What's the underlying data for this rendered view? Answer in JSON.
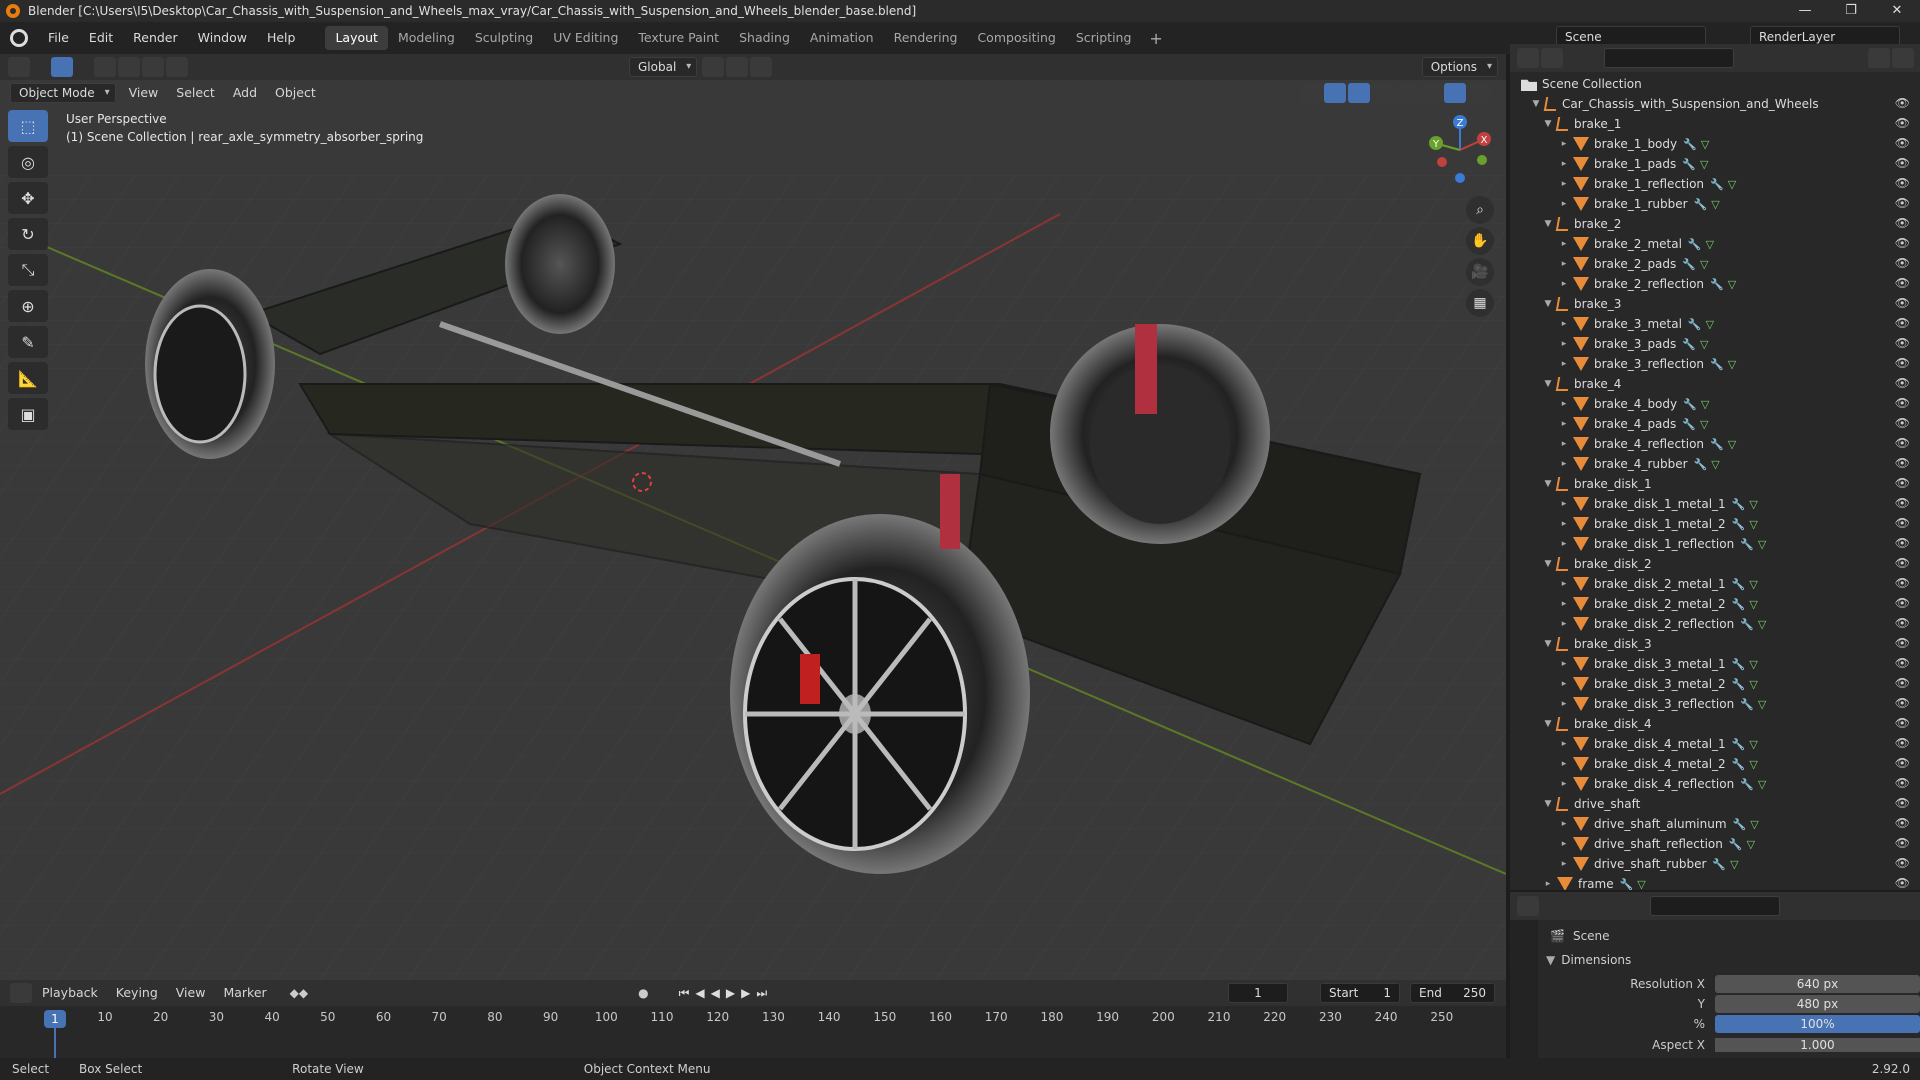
{
  "window": {
    "title": "Blender [C:\\Users\\I5\\Desktop\\Car_Chassis_with_Suspension_and_Wheels_max_vray/Car_Chassis_with_Suspension_and_Wheels_blender_base.blend]",
    "minimize": "—",
    "maximize": "❐",
    "close": "✕"
  },
  "menubar": {
    "menus": [
      "File",
      "Edit",
      "Render",
      "Window",
      "Help"
    ],
    "workspaces": [
      "Layout",
      "Modeling",
      "Sculpting",
      "UV Editing",
      "Texture Paint",
      "Shading",
      "Animation",
      "Rendering",
      "Compositing",
      "Scripting"
    ],
    "active_workspace": "Layout",
    "add": "+",
    "scene": "Scene",
    "view_layer": "RenderLayer"
  },
  "viewport_header": {
    "transform_orientation": "Global",
    "options": "Options",
    "mode": "Object Mode",
    "menus": [
      "View",
      "Select",
      "Add",
      "Object"
    ]
  },
  "viewport": {
    "perspective": "User Perspective",
    "context": "(1) Scene Collection | rear_axle_symmetry_absorber_spring",
    "gizmo": {
      "x": "X",
      "y": "Y",
      "z": "Z"
    }
  },
  "outliner": {
    "root": "Scene Collection",
    "collection": "Car_Chassis_with_Suspension_and_Wheels",
    "groups": [
      {
        "name": "brake_1",
        "children": [
          "brake_1_body",
          "brake_1_pads",
          "brake_1_reflection",
          "brake_1_rubber"
        ]
      },
      {
        "name": "brake_2",
        "children": [
          "brake_2_metal",
          "brake_2_pads",
          "brake_2_reflection"
        ]
      },
      {
        "name": "brake_3",
        "children": [
          "brake_3_metal",
          "brake_3_pads",
          "brake_3_reflection"
        ]
      },
      {
        "name": "brake_4",
        "children": [
          "brake_4_body",
          "brake_4_pads",
          "brake_4_reflection",
          "brake_4_rubber"
        ]
      },
      {
        "name": "brake_disk_1",
        "children": [
          "brake_disk_1_metal_1",
          "brake_disk_1_metal_2",
          "brake_disk_1_reflection"
        ]
      },
      {
        "name": "brake_disk_2",
        "children": [
          "brake_disk_2_metal_1",
          "brake_disk_2_metal_2",
          "brake_disk_2_reflection"
        ]
      },
      {
        "name": "brake_disk_3",
        "children": [
          "brake_disk_3_metal_1",
          "brake_disk_3_metal_2",
          "brake_disk_3_reflection"
        ]
      },
      {
        "name": "brake_disk_4",
        "children": [
          "brake_disk_4_metal_1",
          "brake_disk_4_metal_2",
          "brake_disk_4_reflection"
        ]
      },
      {
        "name": "drive_shaft",
        "children": [
          "drive_shaft_aluminum",
          "drive_shaft_reflection",
          "drive_shaft_rubber"
        ]
      }
    ],
    "last_item": "frame"
  },
  "properties": {
    "scene": "Scene",
    "panel": "Dimensions",
    "resolution_x_label": "Resolution X",
    "resolution_x": "640 px",
    "y_label": "Y",
    "resolution_y": "480 px",
    "pct_label": "%",
    "resolution_pct": "100%",
    "aspect_label": "Aspect X",
    "aspect_x": "1.000"
  },
  "timeline": {
    "menus": [
      "Playback",
      "Keying",
      "View",
      "Marker"
    ],
    "current_frame": "1",
    "start_label": "Start",
    "start": "1",
    "end_label": "End",
    "end": "250",
    "ticks": [
      "10",
      "20",
      "30",
      "40",
      "50",
      "60",
      "70",
      "80",
      "90",
      "100",
      "110",
      "120",
      "130",
      "140",
      "150",
      "160",
      "170",
      "180",
      "190",
      "200",
      "210",
      "220",
      "230",
      "240",
      "250"
    ],
    "playhead": "1"
  },
  "statusbar": {
    "select": "Select",
    "box_select": "Box Select",
    "rotate": "Rotate View",
    "context_menu": "Object Context Menu",
    "version": "2.92.0"
  },
  "colors": {
    "accent": "#4772b3",
    "object": "#e88c3a",
    "modifier": "#5fa3e0",
    "mesh": "#77d169"
  }
}
